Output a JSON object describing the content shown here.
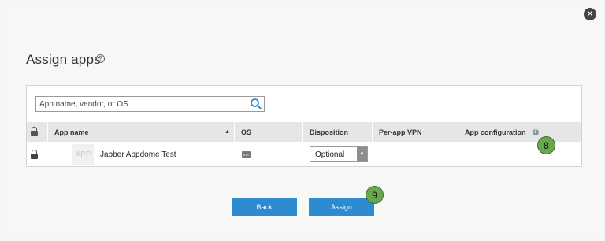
{
  "dialog": {
    "title": "Assign apps",
    "help_icon": "?",
    "close_icon": "✕"
  },
  "search": {
    "placeholder": "App name, vendor, or OS"
  },
  "table": {
    "headers": {
      "app_name": "App name",
      "os": "OS",
      "disposition": "Disposition",
      "per_app_vpn": "Per-app VPN",
      "app_configuration": "App configuration"
    },
    "rows": [
      {
        "thumb_text": "APP",
        "app_name": "Jabber Appdome Test",
        "os_badge": "iOS",
        "disposition": "Optional",
        "per_app_vpn": "",
        "app_configuration": ""
      }
    ]
  },
  "buttons": {
    "back": "Back",
    "assign": "Assign"
  },
  "annotations": {
    "step_8": "8",
    "step_9": "9"
  },
  "colors": {
    "primary_button": "#2e8bd0",
    "annotation_green": "#6aa84f",
    "header_bg": "#e6e6e6"
  }
}
